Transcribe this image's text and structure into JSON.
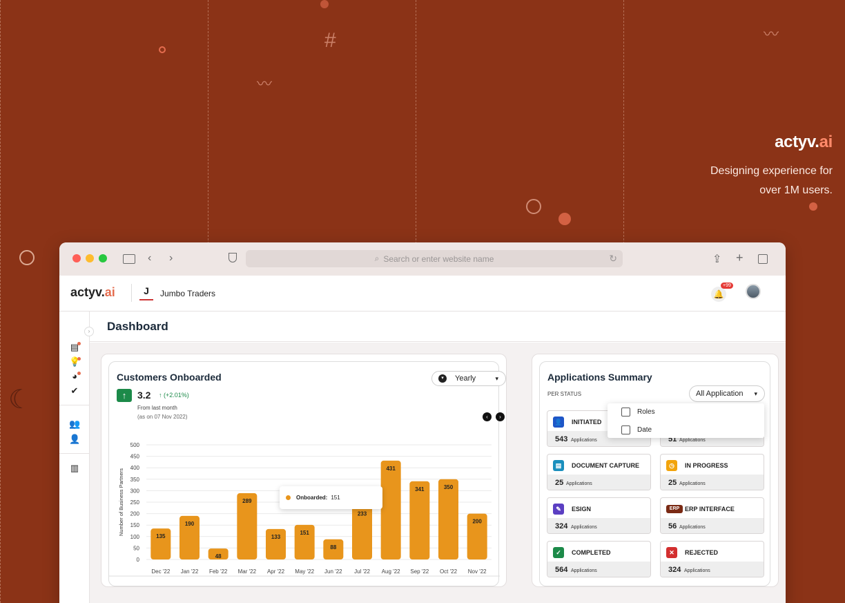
{
  "hero": {
    "logo_main": "actyv.",
    "logo_ai": "ai",
    "tagline_1": "Designing experience for",
    "tagline_2": "over 1M users."
  },
  "browser": {
    "address_placeholder": "Search or enter website name"
  },
  "app": {
    "logo_main": "actyv.",
    "logo_ai": "ai",
    "org_initial": "J",
    "org_name": "Jumbo Traders",
    "notification_badge": "+99"
  },
  "page": {
    "title": "Dashboard"
  },
  "onboarded": {
    "title": "Customers Onboarded",
    "period": "Yearly",
    "value": "3.2",
    "delta": "(+2.01%)",
    "from_label": "From last month",
    "as_on": "(as on 07 Nov 2022)",
    "tooltip_label": "Onboarded:",
    "tooltip_value": "151"
  },
  "chart_data": {
    "type": "bar",
    "ylabel": "Number of Business Partners",
    "ylim": [
      0,
      500
    ],
    "yticks": [
      0,
      50,
      100,
      150,
      200,
      250,
      300,
      350,
      400,
      450,
      500
    ],
    "categories": [
      "Dec '22",
      "Jan '22",
      "Feb '22",
      "Mar '22",
      "Apr '22",
      "May '22",
      "Jun '22",
      "Jul '22",
      "Aug '22",
      "Sep '22",
      "Oct '22",
      "Nov '22"
    ],
    "values": [
      135,
      190,
      48,
      289,
      133,
      151,
      88,
      233,
      431,
      341,
      350,
      200
    ],
    "grid": true,
    "color": "#e8951c"
  },
  "summary": {
    "title": "Applications Summary",
    "subtitle": "PER STATUS",
    "filter": "All Application",
    "dropdown_items": [
      "Roles",
      "Date"
    ],
    "apps_label": "Applications",
    "statuses": [
      {
        "label": "INITIATED",
        "count": "543",
        "color": "#1e56c7",
        "icon": "person-add-icon",
        "glyph": "👤"
      },
      {
        "label": "",
        "count": "51",
        "color": "#1e56c7",
        "icon": "hidden-icon",
        "glyph": ""
      },
      {
        "label": "DOCUMENT CAPTURE",
        "count": "25",
        "color": "#1a8fbd",
        "icon": "document-icon",
        "glyph": "▤"
      },
      {
        "label": "IN PROGRESS",
        "count": "25",
        "color": "#f2a40c",
        "icon": "clock-icon",
        "glyph": "◷"
      },
      {
        "label": "ESIGN",
        "count": "324",
        "color": "#5b3fc2",
        "icon": "pen-icon",
        "glyph": "✎"
      },
      {
        "label": "ERP INTERFACE",
        "count": "56",
        "color": "#7a2a14",
        "icon": "erp-icon",
        "glyph": "ERP"
      },
      {
        "label": "COMPLETED",
        "count": "564",
        "color": "#1c8a49",
        "icon": "check-icon",
        "glyph": "✓"
      },
      {
        "label": "REJECTED",
        "count": "324",
        "color": "#d32f2f",
        "icon": "cross-icon",
        "glyph": "✕"
      }
    ]
  }
}
